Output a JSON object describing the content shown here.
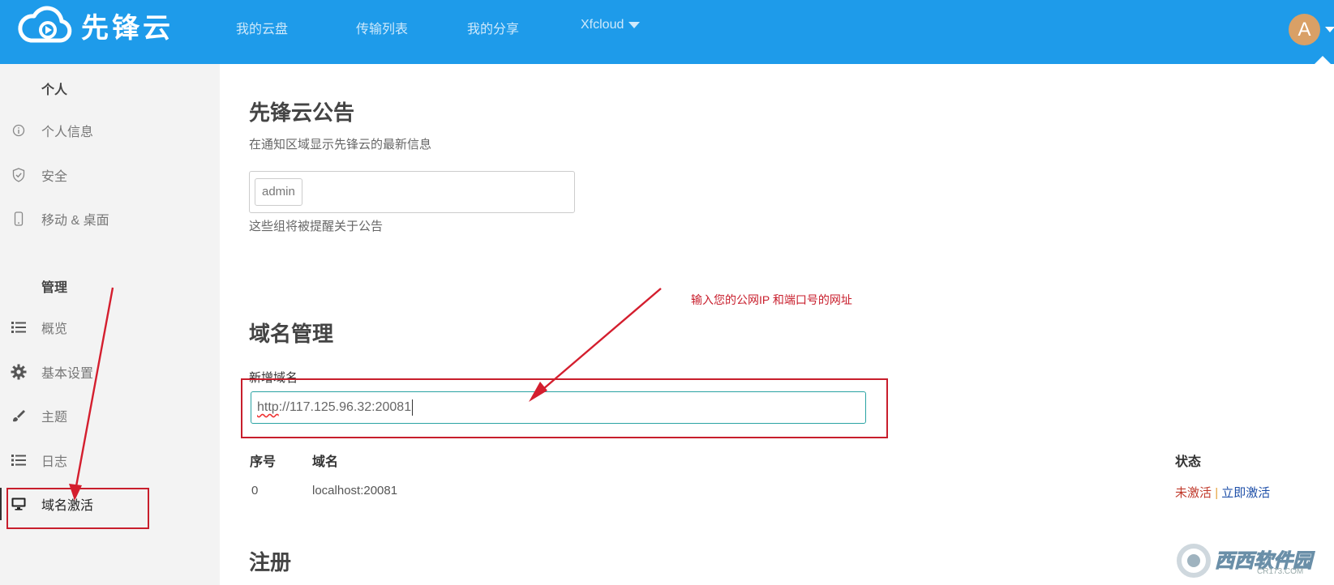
{
  "header": {
    "app_name": "先锋云",
    "nav": [
      "我的云盘",
      "传输列表",
      "我的分享",
      "Xfcloud"
    ],
    "user_initial": "A"
  },
  "sidebar": {
    "personal_heading": "个人",
    "personal_items": [
      "个人信息",
      "安全",
      "移动 & 桌面"
    ],
    "admin_heading": "管理",
    "admin_items": [
      "概览",
      "基本设置",
      "主题",
      "日志",
      "域名激活"
    ]
  },
  "announcement": {
    "title": "先锋云公告",
    "description": "在通知区域显示先锋云的最新信息",
    "groups": [
      "admin"
    ],
    "hint": "这些组将被提醒关于公告"
  },
  "domain": {
    "title": "域名管理",
    "new_label": "新增域名",
    "input_value_scheme": "http",
    "input_value_rest": "://117.125.96.32:20081",
    "columns": [
      "序号",
      "域名",
      "状态"
    ],
    "rows": [
      {
        "index": "0",
        "domain": "localhost:20081",
        "status_inactive": "未激活",
        "separator": "|",
        "activate": "立即激活"
      }
    ]
  },
  "register": {
    "title": "注册"
  },
  "annotation": {
    "text": "输入您的公网IP 和端口号的网址"
  },
  "watermark": {
    "text": "西西软件园",
    "subtext": "CR173.COM"
  },
  "colors": {
    "header_bg": "#1e9bea",
    "sidebar_bg": "#f3f3f3",
    "annotation_red": "#c81e2c",
    "status_inactive": "#c0392b",
    "status_link": "#1e4fa8"
  }
}
